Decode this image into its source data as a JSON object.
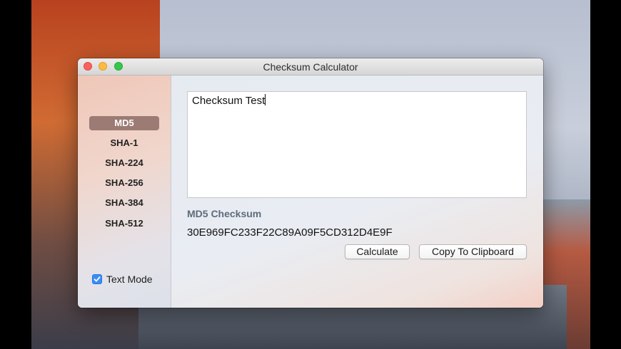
{
  "window": {
    "title": "Checksum Calculator"
  },
  "sidebar": {
    "algorithms": [
      "MD5",
      "SHA-1",
      "SHA-224",
      "SHA-256",
      "SHA-384",
      "SHA-512"
    ],
    "selected": "MD5",
    "text_mode_label": "Text Mode",
    "text_mode_checked": true
  },
  "main": {
    "input_text": "Checksum Test",
    "checksum_label": "MD5 Checksum",
    "checksum_value": "30E969FC233F22C89A09F5CD312D4E9F",
    "calculate_label": "Calculate",
    "copy_label": "Copy To Clipboard"
  },
  "colors": {
    "selected_item": "#9b7b74",
    "checkbox": "#3a8ef5",
    "checksum_label": "#5d6b7b"
  }
}
